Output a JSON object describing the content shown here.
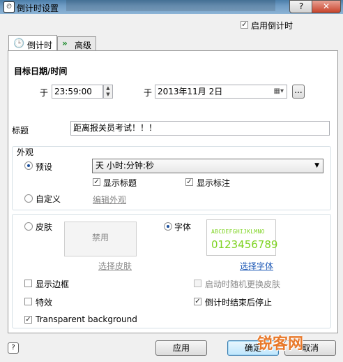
{
  "window": {
    "title": "倒计时设置",
    "help_label": "?",
    "close_label": "✕"
  },
  "enable_countdown": {
    "label": "启用倒计时",
    "checked": true
  },
  "tabs": [
    {
      "label": "倒计时",
      "icon": "clock-icon",
      "active": true
    },
    {
      "label": "高级",
      "icon": "double-chevron-icon",
      "active": false
    }
  ],
  "target": {
    "heading": "目标日期/时间",
    "time_prefix": "于",
    "time_value": "23:59:00",
    "date_prefix": "于",
    "date_value": "2013年11月  2日",
    "ellipsis_label": "..."
  },
  "title_field": {
    "label": "标题",
    "value": "距离报关员考试！！！"
  },
  "appearance": {
    "heading": "外观",
    "preset_label": "预设",
    "preset_value": "天 小时:分钟:秒",
    "show_title_label": "显示标题",
    "show_marks_label": "显示标注",
    "custom_label": "自定义",
    "edit_link": "编辑外观"
  },
  "skin": {
    "label": "皮肤",
    "disabled_text": "禁用",
    "choose_skin_link": "选择皮肤",
    "font_label": "字体",
    "font_preview_letters": "ABCDEFGHIJKLMNO",
    "font_preview_digits": "0123456789",
    "font_preview_color": "#7ed321",
    "choose_font_link": "选择字体"
  },
  "options": {
    "show_border": "显示边框",
    "random_skin": "启动时随机更换皮肤",
    "effects": "特效",
    "stop_on_end": "倒计时结束后停止",
    "transparent_bg": "Transparent background"
  },
  "footer": {
    "apply": "应用",
    "ok": "确定",
    "cancel": "取消",
    "help_icon": "help-icon"
  },
  "watermark": "锐客网"
}
